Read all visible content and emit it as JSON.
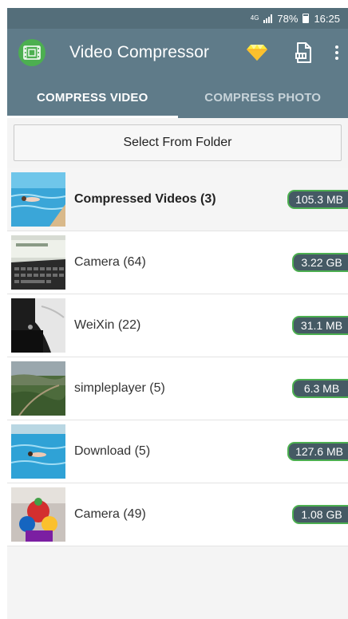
{
  "status_bar": {
    "network": "4G",
    "battery": "78%",
    "time": "16:25"
  },
  "app_bar": {
    "title": "Video Compressor",
    "icons": [
      "app-logo-icon",
      "premium-gem-icon",
      "zip-file-icon",
      "more-vert-icon"
    ]
  },
  "tabs": [
    {
      "label": "COMPRESS VIDEO",
      "selected": true
    },
    {
      "label": "COMPRESS PHOTO",
      "selected": false
    }
  ],
  "folder_button": {
    "label": "Select From Folder"
  },
  "folders": [
    {
      "label": "Compressed Videos (3)",
      "size": "105.3 MB",
      "thumbnail": "swimming-pool"
    },
    {
      "label": "Camera (64)",
      "size": "3.22 GB",
      "thumbnail": "laptop-keyboard"
    },
    {
      "label": "WeiXin (22)",
      "size": "31.1 MB",
      "thumbnail": "car"
    },
    {
      "label": "simpleplayer (5)",
      "size": "6.3 MB",
      "thumbnail": "aerial-landscape"
    },
    {
      "label": "Download (5)",
      "size": "127.6 MB",
      "thumbnail": "swimming-pool"
    },
    {
      "label": "Camera (49)",
      "size": "1.08 GB",
      "thumbnail": "kiddie-ride"
    }
  ],
  "colors": {
    "app_bar": "#5f7b89",
    "status_bar": "#546e7a",
    "badge_bg": "#455a64",
    "badge_border": "#4caf50",
    "premium_gem": "#ffeb3b"
  }
}
